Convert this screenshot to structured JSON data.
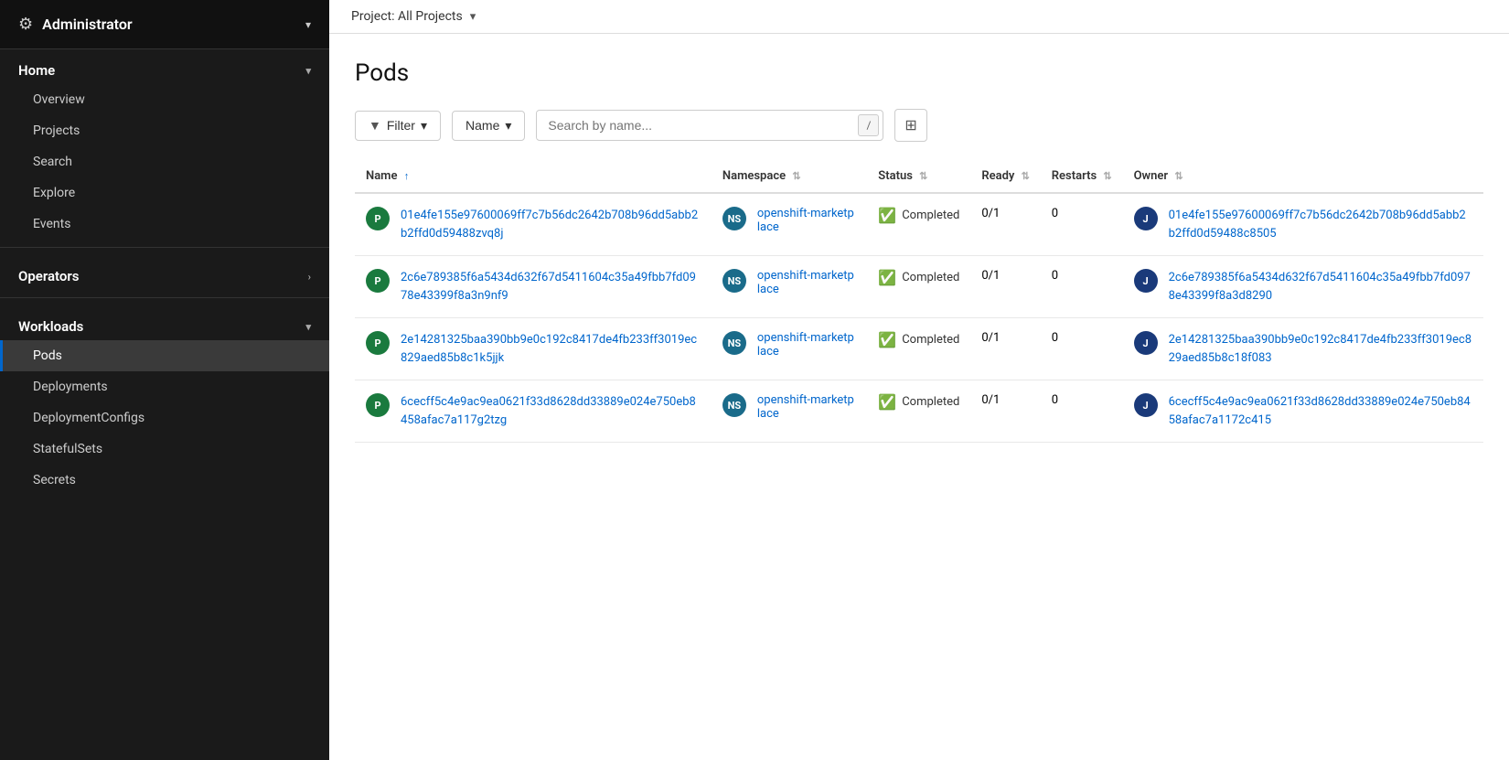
{
  "sidebar": {
    "admin_label": "Administrator",
    "admin_icon": "⚙",
    "admin_arrow": "▾",
    "home_label": "Home",
    "home_arrow": "▾",
    "home_items": [
      {
        "label": "Overview",
        "active": false
      },
      {
        "label": "Projects",
        "active": false
      },
      {
        "label": "Search",
        "active": false
      },
      {
        "label": "Explore",
        "active": false
      },
      {
        "label": "Events",
        "active": false
      }
    ],
    "operators_label": "Operators",
    "operators_arrow": "›",
    "workloads_label": "Workloads",
    "workloads_arrow": "▾",
    "workloads_items": [
      {
        "label": "Pods",
        "active": true
      },
      {
        "label": "Deployments",
        "active": false
      },
      {
        "label": "DeploymentConfigs",
        "active": false
      },
      {
        "label": "StatefulSets",
        "active": false
      },
      {
        "label": "Secrets",
        "active": false
      }
    ]
  },
  "topbar": {
    "project_label": "Project: All Projects",
    "project_chevron": "▾"
  },
  "main": {
    "page_title": "Pods",
    "filter_btn": "Filter",
    "name_select": "Name",
    "search_placeholder": "Search by name...",
    "search_kbd": "/",
    "columns_icon": "⊞"
  },
  "table": {
    "headers": [
      {
        "label": "Name",
        "sort": "asc"
      },
      {
        "label": "Namespace",
        "sort": "none"
      },
      {
        "label": "Status",
        "sort": "none"
      },
      {
        "label": "Ready",
        "sort": "none"
      },
      {
        "label": "Restarts",
        "sort": "none"
      },
      {
        "label": "Owner",
        "sort": "none"
      }
    ],
    "rows": [
      {
        "name": "01e4fe155e97600069ff7c7b56dc2642b708b96dd5abb2b2ffd0d59488zvq8j",
        "name_badge": "P",
        "namespace": "openshift-marketplace",
        "ns_badge": "NS",
        "status": "Completed",
        "ready": "0/1",
        "restarts": "0",
        "owner": "01e4fe155e97600069ff7c7b56dc2642b708b96dd5abb2b2ffd0d59488c8505",
        "owner_badge": "J"
      },
      {
        "name": "2c6e789385f6a5434d632f67d5411604c35a49fbb7fd0978e43399f8a3n9nf9",
        "name_badge": "P",
        "namespace": "openshift-marketplace",
        "ns_badge": "NS",
        "status": "Completed",
        "ready": "0/1",
        "restarts": "0",
        "owner": "2c6e789385f6a5434d632f67d5411604c35a49fbb7fd0978e43399f8a3d8290",
        "owner_badge": "J"
      },
      {
        "name": "2e14281325baa390bb9e0c192c8417de4fb233ff3019ec829aed85b8c1k5jjk",
        "name_badge": "P",
        "namespace": "openshift-marketplace",
        "ns_badge": "NS",
        "status": "Completed",
        "ready": "0/1",
        "restarts": "0",
        "owner": "2e14281325baa390bb9e0c192c8417de4fb233ff3019ec829aed85b8c18f083",
        "owner_badge": "J"
      },
      {
        "name": "6cecff5c4e9ac9ea0621f33d8628dd33889e024e750eb8458afac7a117g2tzg",
        "name_badge": "P",
        "namespace": "openshift-marketplace",
        "ns_badge": "NS",
        "status": "Completed",
        "ready": "0/1",
        "restarts": "0",
        "owner": "6cecff5c4e9ac9ea0621f33d8628dd33889e024e750eb8458afac7a1172c415",
        "owner_badge": "J"
      }
    ]
  }
}
